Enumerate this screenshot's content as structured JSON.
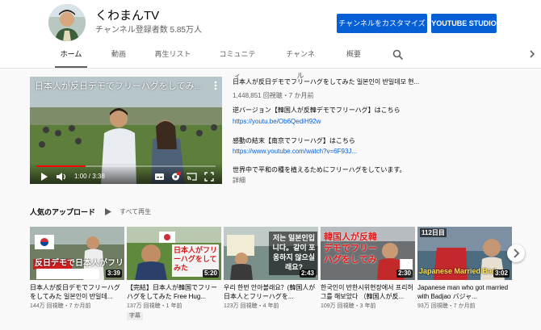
{
  "channel": {
    "name": "くわまんTV",
    "subscribers": "チャンネル登録者数 5.85万人",
    "customize_label": "チャンネルをカスタマイズ",
    "studio_label": "YOUTUBE STUDIO"
  },
  "tabs": [
    {
      "label": "ホーム",
      "active": true
    },
    {
      "label": "動画"
    },
    {
      "label": "再生リスト"
    },
    {
      "label": "コミュニティ"
    },
    {
      "label": "チャンネル"
    },
    {
      "label": "概要"
    }
  ],
  "icons": {
    "search": "search-icon",
    "tabs_scroll": "chevron-right-icon",
    "next": "chevron-right-icon"
  },
  "featured": {
    "player_title": "日本人が反日デモでフリーハグをしてみ...",
    "time": "1:00 / 3:38",
    "progress": 0.275,
    "title": "日本人が反日デモでフリーハグをしてみた 일본인이 반일데모 현...",
    "meta": "1,448,851 回視聴・7 か月前",
    "line1": "逆バージョン【韓国人が反韓デモでフリーハグ】はこちら",
    "link1": "https://youtu.be/Ob6QediH92w",
    "line2": "感動の結末【南京でフリーハグ】はこちら",
    "link2": "https://www.youtube.com/watch?v=6F93J...",
    "line3": "世界中で平和の種を植えるためにフリーハグをしています。",
    "more": "詳細"
  },
  "shelf": {
    "title": "人気のアップロード",
    "play_all": "すべて再生",
    "videos": [
      {
        "thumb_text": "反日デモで日本人がフリーハ",
        "duration": "3:39",
        "title": "日本人が反日デモでフリーハグをしてみた 일본인이 반일데...",
        "meta": "144万 回視聴・7 か月前"
      },
      {
        "thumb_text": "日本人がフリーハグをしてみた",
        "duration": "5:20",
        "title": "【完結】日本人が韓国でフリーハグをしてみた Free Hug...",
        "meta": "137万 回視聴・1 年前",
        "badge": "字幕"
      },
      {
        "thumb_text": "저는 일본인입니다。같이 포옹하지 않으실래요?",
        "duration": "2:43",
        "title": "우리 한번 안아볼래요？(韓国人が日本人とフリーハグを...",
        "meta": "123万 回視聴・4 年前"
      },
      {
        "thumb_text": "韓国人が反韓デモでフリーハグをしてみ",
        "duration": "2:30",
        "title": "한국인이 반한시위현장에서 프리허그를 해보았다 （韓国人が反...",
        "meta": "109万 回視聴・3 年前"
      },
      {
        "thumb_text": "Japanese Married Bad",
        "duration": "3:02",
        "title": "Japanese man who got married with Badjao バジャ...",
        "meta": "93万 回視聴・7 か月前",
        "day_tag": "112日目"
      }
    ]
  }
}
